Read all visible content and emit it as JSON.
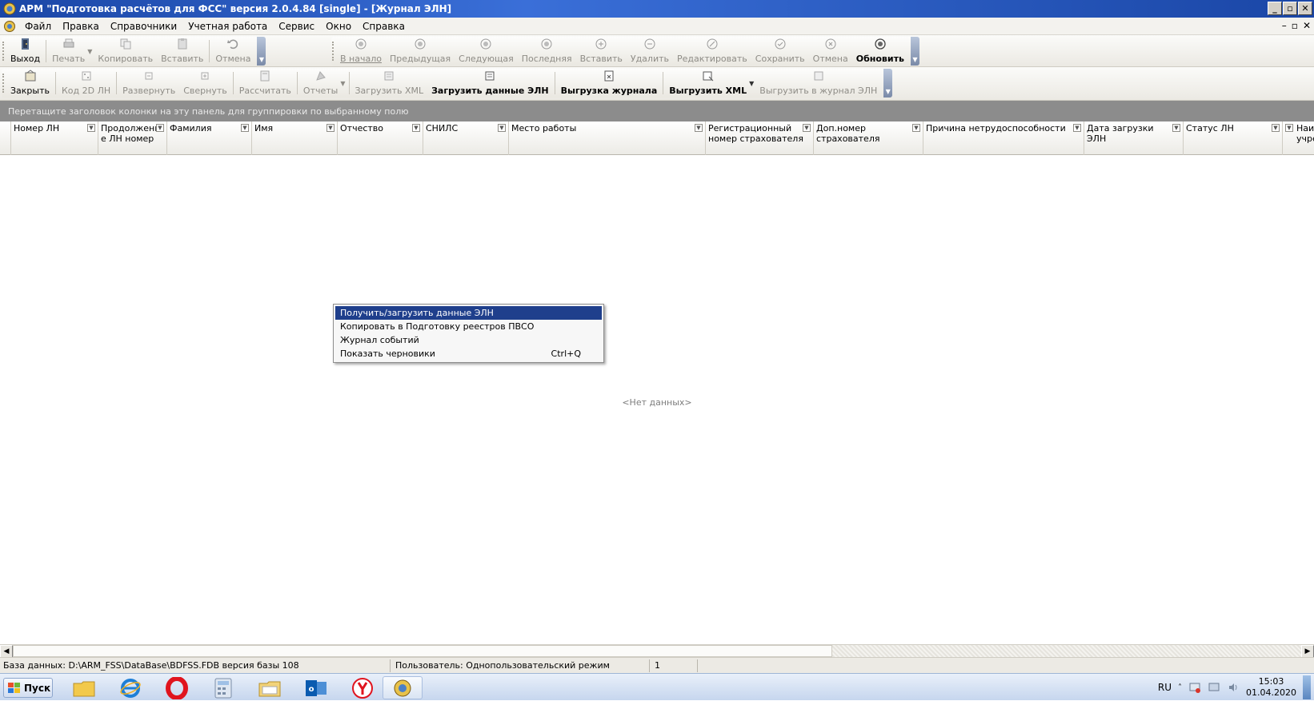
{
  "window": {
    "title": "АРМ \"Подготовка расчётов для ФСС\"  версия 2.0.4.84 [single] - [Журнал ЭЛН]",
    "min_label": "_",
    "max_label": "▫",
    "close_label": "✕"
  },
  "menu": {
    "items": [
      "Файл",
      "Правка",
      "Справочники",
      "Учетная работа",
      "Сервис",
      "Окно",
      "Справка"
    ],
    "mdi_min": "–",
    "mdi_restore": "▫",
    "mdi_close": "✕"
  },
  "toolbar1": {
    "group1": [
      {
        "label": "Выход",
        "icon": "exit-icon",
        "enabled": true
      },
      {
        "label": "Печать",
        "icon": "printer-icon",
        "enabled": false
      },
      {
        "label": "Копировать",
        "icon": "copy-icon",
        "enabled": false
      },
      {
        "label": "Вставить",
        "icon": "paste-icon",
        "enabled": false
      },
      {
        "label": "Отмена",
        "icon": "undo-icon",
        "enabled": false
      }
    ],
    "group2": [
      {
        "label": "В начало",
        "icon": "first-record-icon",
        "enabled": false
      },
      {
        "label": "Предыдущая",
        "icon": "prev-record-icon",
        "enabled": false
      },
      {
        "label": "Следующая",
        "icon": "next-record-icon",
        "enabled": false
      },
      {
        "label": "Последняя",
        "icon": "last-record-icon",
        "enabled": false
      },
      {
        "label": "Вставить",
        "icon": "insert-record-icon",
        "enabled": false
      },
      {
        "label": "Удалить",
        "icon": "delete-record-icon",
        "enabled": false
      },
      {
        "label": "Редактировать",
        "icon": "edit-record-icon",
        "enabled": false
      },
      {
        "label": "Сохранить",
        "icon": "save-record-icon",
        "enabled": false
      },
      {
        "label": "Отмена",
        "icon": "cancel-record-icon",
        "enabled": false
      },
      {
        "label": "Обновить",
        "icon": "refresh-icon",
        "enabled": true
      }
    ]
  },
  "toolbar2": {
    "items": [
      {
        "label": "Закрыть",
        "icon": "close-doc-icon",
        "enabled": true
      },
      {
        "label": "Код 2D ЛН",
        "icon": "barcode-icon",
        "enabled": false
      },
      {
        "label": "Развернуть",
        "icon": "expand-icon",
        "enabled": false
      },
      {
        "label": "Свернуть",
        "icon": "collapse-icon",
        "enabled": false
      },
      {
        "label": "Рассчитать",
        "icon": "calculate-icon",
        "enabled": false
      },
      {
        "label": "Отчеты",
        "icon": "reports-icon",
        "enabled": false
      },
      {
        "label": "Загрузить XML",
        "icon": "load-xml-icon",
        "enabled": false
      },
      {
        "label": "Загрузить данные ЭЛН",
        "icon": "load-eln-icon",
        "enabled": true
      },
      {
        "label": "Выгрузка журнала",
        "icon": "export-journal-icon",
        "enabled": true
      },
      {
        "label": "Выгрузить XML",
        "icon": "export-xml-icon",
        "enabled": true
      },
      {
        "label": "Выгрузить в журнал ЭЛН",
        "icon": "export-to-journal-icon",
        "enabled": false
      }
    ]
  },
  "group_panel_text": "Перетащите заголовок колонки на эту панель для группировки по выбранному полю",
  "columns": [
    {
      "line1": "Номер ЛН",
      "line2": ""
    },
    {
      "line1": "Продолжени",
      "line2": "е ЛН номер"
    },
    {
      "line1": "Фамилия",
      "line2": ""
    },
    {
      "line1": "Имя",
      "line2": ""
    },
    {
      "line1": "Отчество",
      "line2": ""
    },
    {
      "line1": "СНИЛС",
      "line2": ""
    },
    {
      "line1": "Место работы",
      "line2": ""
    },
    {
      "line1": "Регистрационный",
      "line2": "номер страхователя"
    },
    {
      "line1": "Доп.номер",
      "line2": "страхователя"
    },
    {
      "line1": "Причина нетрудоспособности",
      "line2": ""
    },
    {
      "line1": "Дата загрузки",
      "line2": "ЭЛН"
    },
    {
      "line1": "Статус ЛН",
      "line2": ""
    },
    {
      "line1": "Наи",
      "line2": "учре"
    }
  ],
  "no_data_text": "<Нет данных>",
  "context_menu": [
    {
      "label": "Получить/загрузить данные ЭЛН",
      "shortcut": "",
      "active": true
    },
    {
      "label": "Копировать в Подготовку реестров ПВСО",
      "shortcut": "",
      "active": false
    },
    {
      "label": "Журнал событий",
      "shortcut": "",
      "active": false
    },
    {
      "label": "Показать черновики",
      "shortcut": "Ctrl+Q",
      "active": false
    }
  ],
  "status": {
    "database": "База данных: D:\\ARM_FSS\\DataBase\\BDFSS.FDB  версия базы 108",
    "user": "Пользователь: Однопользовательский режим",
    "count": "1"
  },
  "taskbar": {
    "start_label": "Пуск",
    "language": "RU",
    "time": "15:03",
    "date": "01.04.2020"
  },
  "colors": {
    "title_bar": "#1a46a6",
    "menu_highlight": "#1f3f8c",
    "group_panel": "#8c8c8c"
  }
}
